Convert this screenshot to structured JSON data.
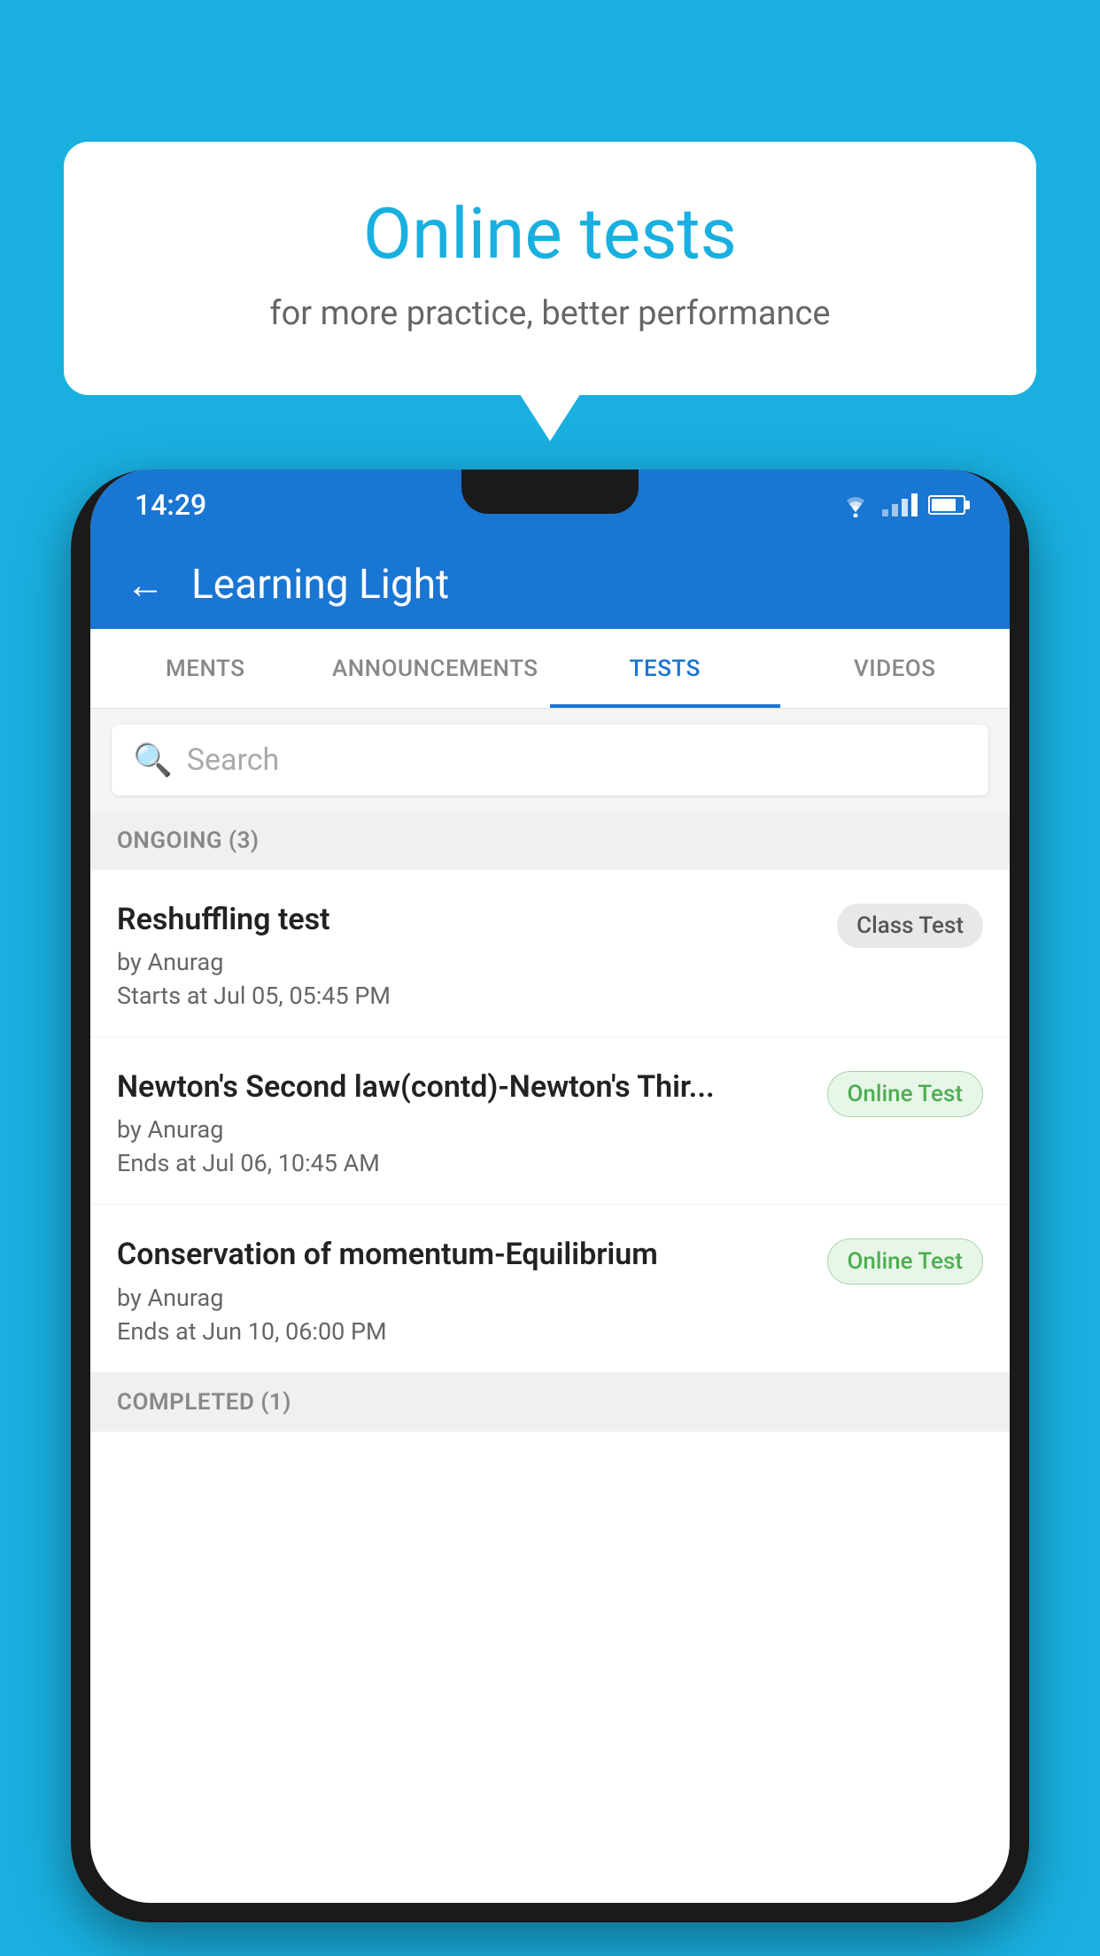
{
  "background": {
    "color": "#19B0E0"
  },
  "speech_bubble": {
    "title": "Online tests",
    "subtitle": "for more practice, better performance"
  },
  "phone": {
    "status_bar": {
      "time": "14:29"
    },
    "header": {
      "title": "Learning Light",
      "back_label": "←"
    },
    "tabs": [
      {
        "label": "MENTS",
        "active": false
      },
      {
        "label": "ANNOUNCEMENTS",
        "active": false
      },
      {
        "label": "TESTS",
        "active": true
      },
      {
        "label": "VIDEOS",
        "active": false
      }
    ],
    "search": {
      "placeholder": "Search"
    },
    "ongoing_section": {
      "label": "ONGOING (3)"
    },
    "tests": [
      {
        "name": "Reshuffling test",
        "by": "by Anurag",
        "time": "Starts at  Jul 05, 05:45 PM",
        "badge": "Class Test",
        "badge_type": "class"
      },
      {
        "name": "Newton's Second law(contd)-Newton's Thir...",
        "by": "by Anurag",
        "time": "Ends at  Jul 06, 10:45 AM",
        "badge": "Online Test",
        "badge_type": "online"
      },
      {
        "name": "Conservation of momentum-Equilibrium",
        "by": "by Anurag",
        "time": "Ends at  Jun 10, 06:00 PM",
        "badge": "Online Test",
        "badge_type": "online"
      }
    ],
    "completed_section": {
      "label": "COMPLETED (1)"
    }
  }
}
